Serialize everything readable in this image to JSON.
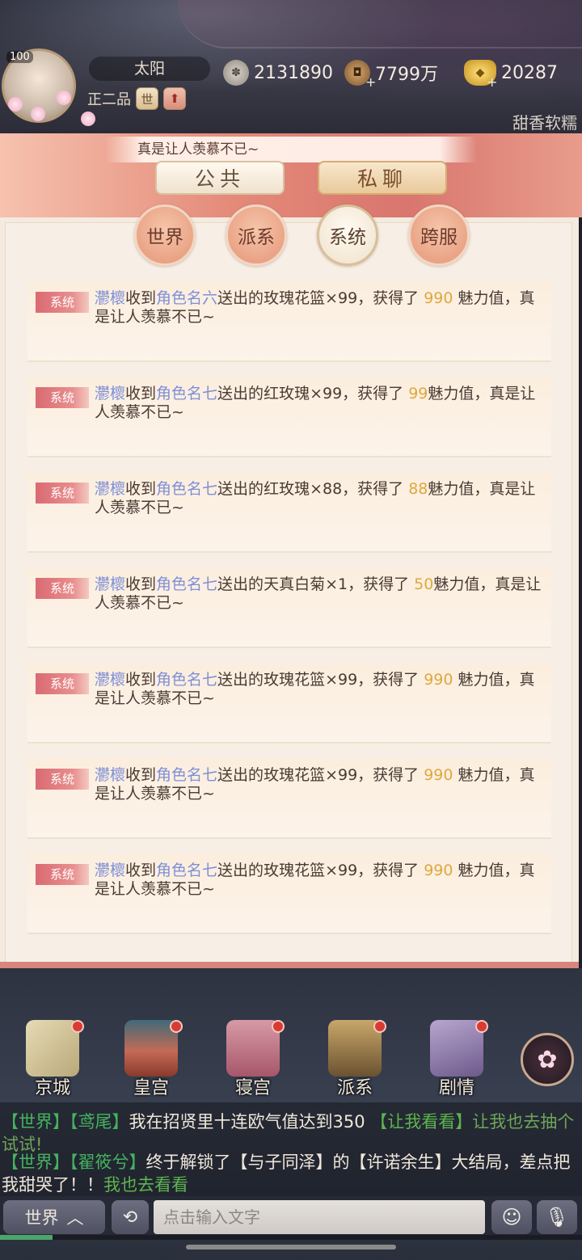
{
  "player": {
    "level": "100",
    "name": "太阳",
    "rank": "正二品",
    "rank_button": "世",
    "rank_up_icon": "arrow-up"
  },
  "resources": {
    "silver": "2131890",
    "copper": "7799万",
    "gold": "20287",
    "plus": "+"
  },
  "top_right_name": "甜香软糯",
  "banner_text": "真是让人羡慕不已~",
  "main_tabs": [
    "公共",
    "私聊"
  ],
  "sub_tabs": [
    "世界",
    "派系",
    "系统",
    "跨服"
  ],
  "active_sub_tab": "系统",
  "messages": [
    {
      "tag": "系统",
      "receiver": "灪櫰",
      "verb1": "收到",
      "sender": "角色名六",
      "verb2": "送出的",
      "item": "玫瑰花篮×99",
      "mid": "，获得了 ",
      "charm": "990",
      "tail": " 魅力值，真是让人羡慕不已~"
    },
    {
      "tag": "系统",
      "receiver": "灪櫰",
      "verb1": "收到",
      "sender": "角色名七",
      "verb2": "送出的",
      "item": "红玫瑰×99",
      "mid": "，获得了 ",
      "charm": "99",
      "tail": "魅力值，真是让人羡慕不已~"
    },
    {
      "tag": "系统",
      "receiver": "灪櫰",
      "verb1": "收到",
      "sender": "角色名七",
      "verb2": "送出的",
      "item": "红玫瑰×88",
      "mid": "，获得了 ",
      "charm": "88",
      "tail": "魅力值，真是让人羡慕不已~"
    },
    {
      "tag": "系统",
      "receiver": "灪櫰",
      "verb1": "收到",
      "sender": "角色名七",
      "verb2": "送出的",
      "item": "天真白菊×1",
      "mid": "，获得了 ",
      "charm": "50",
      "tail": "魅力值，真是让人羡慕不已~"
    },
    {
      "tag": "系统",
      "receiver": "灪櫰",
      "verb1": "收到",
      "sender": "角色名七",
      "verb2": "送出的",
      "item": "玫瑰花篮×99",
      "mid": "，获得了 ",
      "charm": "990",
      "tail": " 魅力值，真是让人羡慕不已~"
    },
    {
      "tag": "系统",
      "receiver": "灪櫰",
      "verb1": "收到",
      "sender": "角色名七",
      "verb2": "送出的",
      "item": "玫瑰花篮×99",
      "mid": "，获得了 ",
      "charm": "990",
      "tail": " 魅力值，真是让人羡慕不已~"
    },
    {
      "tag": "系统",
      "receiver": "灪櫰",
      "verb1": "收到",
      "sender": "角色名七",
      "verb2": "送出的",
      "item": "玫瑰花篮×99",
      "mid": "，获得了 ",
      "charm": "990",
      "tail": " 魅力值，真是让人羡慕不已~"
    }
  ],
  "nav": [
    {
      "label": "京城",
      "icon": "map-icon",
      "color": "#c7b98f"
    },
    {
      "label": "皇宫",
      "icon": "palace-icon",
      "color": "#c46a55"
    },
    {
      "label": "寝宫",
      "icon": "bed-icon",
      "color": "#b06f7a"
    },
    {
      "label": "派系",
      "icon": "faction-icon",
      "color": "#a88752"
    },
    {
      "label": "剧情",
      "icon": "book-icon",
      "color": "#8f7aa8"
    }
  ],
  "flower_icon": "flower-icon",
  "ticker": {
    "line1": {
      "chan": "【世界】",
      "user": "【鸢尾】",
      "text": "我在招贤里十连欧气值达到350 ",
      "link": "【让我看看】",
      "tail": "让我也去抽个试试!"
    },
    "line2": {
      "chan": "【世界】",
      "user": "【翟筱兮】",
      "text": "终于解锁了【与子同泽】的【许诺余生】大结局，差点把我甜哭了！！",
      "link": "我也去看看"
    }
  },
  "input": {
    "channel": "世界",
    "placeholder": "点击输入文字"
  },
  "progress": 0.09,
  "colors": {
    "accent_red": "#d96a72",
    "player_blue": "#7f8fd6",
    "charm_gold": "#e0a83c",
    "channel_green": "#44b35f"
  }
}
